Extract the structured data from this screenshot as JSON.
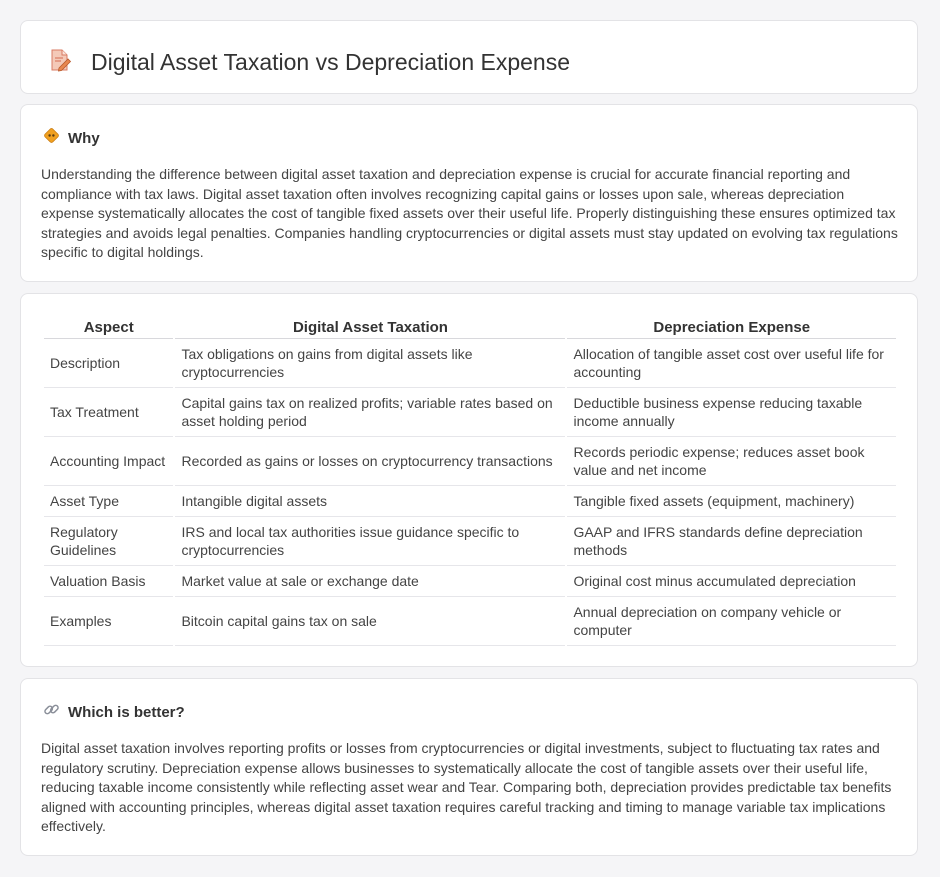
{
  "header": {
    "title": "Digital Asset Taxation vs Depreciation Expense",
    "icon": "document-pencil-icon"
  },
  "why": {
    "heading": "Why",
    "icon": "diamond-sign-icon",
    "text": "Understanding the difference between digital asset taxation and depreciation expense is crucial for accurate financial reporting and compliance with tax laws. Digital asset taxation often involves recognizing capital gains or losses upon sale, whereas depreciation expense systematically allocates the cost of tangible fixed assets over their useful life. Properly distinguishing these ensures optimized tax strategies and avoids legal penalties. Companies handling cryptocurrencies or digital assets must stay updated on evolving tax regulations specific to digital holdings."
  },
  "table": {
    "headers": [
      "Aspect",
      "Digital Asset Taxation",
      "Depreciation Expense"
    ],
    "rows": [
      [
        "Description",
        "Tax obligations on gains from digital assets like cryptocurrencies",
        "Allocation of tangible asset cost over useful life for accounting"
      ],
      [
        "Tax Treatment",
        "Capital gains tax on realized profits; variable rates based on asset holding period",
        "Deductible business expense reducing taxable income annually"
      ],
      [
        "Accounting Impact",
        "Recorded as gains or losses on cryptocurrency transactions",
        "Records periodic expense; reduces asset book value and net income"
      ],
      [
        "Asset Type",
        "Intangible digital assets",
        "Tangible fixed assets (equipment, machinery)"
      ],
      [
        "Regulatory Guidelines",
        "IRS and local tax authorities issue guidance specific to cryptocurrencies",
        "GAAP and IFRS standards define depreciation methods"
      ],
      [
        "Valuation Basis",
        "Market value at sale or exchange date",
        "Original cost minus accumulated depreciation"
      ],
      [
        "Examples",
        "Bitcoin capital gains tax on sale",
        "Annual depreciation on company vehicle or computer"
      ]
    ]
  },
  "better": {
    "heading": "Which is better?",
    "icon": "link-icon",
    "text": "Digital asset taxation involves reporting profits or losses from cryptocurrencies or digital investments, subject to fluctuating tax rates and regulatory scrutiny. Depreciation expense allows businesses to systematically allocate the cost of tangible assets over their useful life, reducing taxable income consistently while reflecting asset wear and Tear. Comparing both, depreciation provides predictable tax benefits aligned with accounting principles, whereas digital asset taxation requires careful tracking and timing to manage variable tax implications effectively."
  }
}
